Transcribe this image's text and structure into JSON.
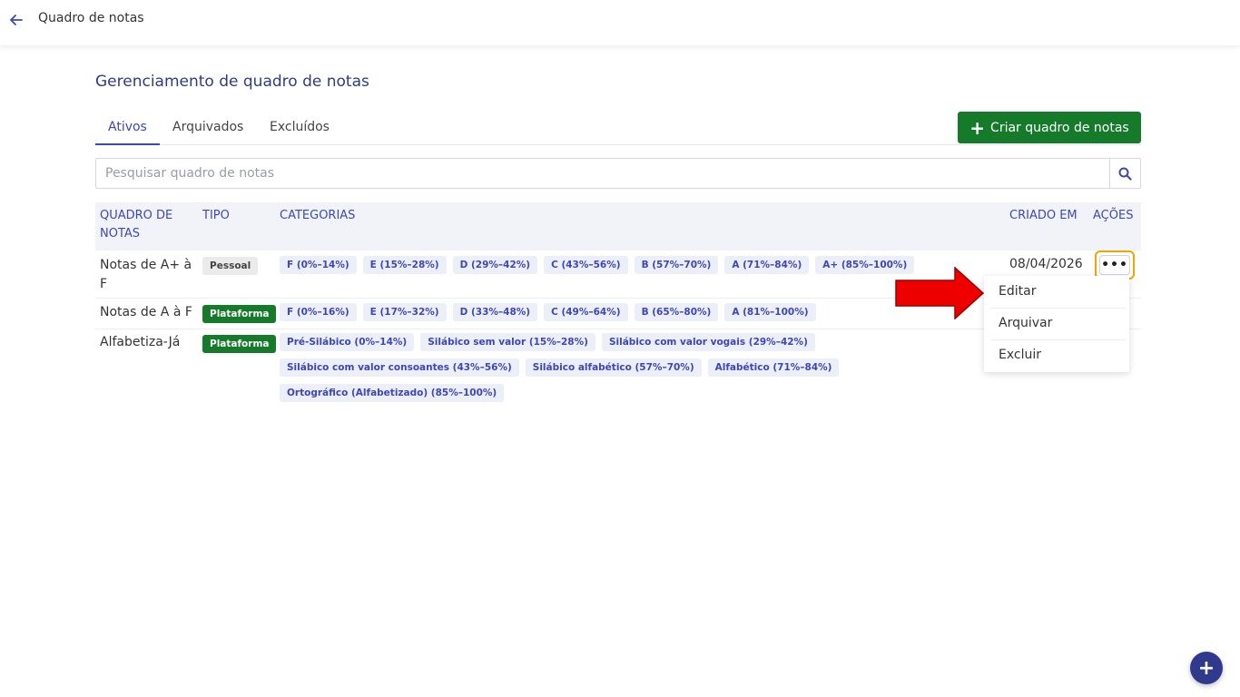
{
  "topbar": {
    "title": "Quadro de notas"
  },
  "page": {
    "title": "Gerenciamento de quadro de notas"
  },
  "tabs": [
    {
      "label": "Ativos",
      "active": true
    },
    {
      "label": "Arquivados",
      "active": false
    },
    {
      "label": "Excluídos",
      "active": false
    }
  ],
  "create_button": {
    "label": "Criar quadro de notas"
  },
  "search": {
    "placeholder": "Pesquisar quadro de notas",
    "value": ""
  },
  "table": {
    "headers": {
      "name_line1": "QUADRO DE",
      "name_line2": "NOTAS",
      "type": "TIPO",
      "categories": "CATEGORIAS",
      "created": "CRIADO EM",
      "actions": "AÇÕES"
    },
    "rows": [
      {
        "name": "Notas de A+ à F",
        "type": "Pessoal",
        "categories": [
          "F (0%–14%)",
          "E (15%–28%)",
          "D (29%–42%)",
          "C (43%–56%)",
          "B (57%–70%)",
          "A (71%–84%)",
          "A+ (85%–100%)"
        ],
        "created": "08/04/2026"
      },
      {
        "name": "Notas de A à F",
        "type": "Plataforma",
        "categories": [
          "F (0%–16%)",
          "E (17%–32%)",
          "D (33%–48%)",
          "C (49%–64%)",
          "B (65%–80%)",
          "A (81%–100%)"
        ],
        "created": ""
      },
      {
        "name": "Alfabetiza-Já",
        "type": "Plataforma",
        "categories": [
          "Pré-Silábico (0%–14%)",
          "Silábico sem valor (15%–28%)",
          "Silábico com valor vogais (29%–42%)",
          "Silábico com valor consoantes (43%–56%)",
          "Silábico alfabético (57%–70%)",
          "Alfabético (71%–84%)",
          "Ortográfico (Alfabetizado) (85%–100%)"
        ],
        "created": ""
      }
    ]
  },
  "actions_menu": {
    "button_glyph": "•••",
    "items": [
      "Editar",
      "Arquivar",
      "Excluir"
    ]
  },
  "fab": {
    "glyph": "+"
  },
  "colors": {
    "primary": "#3d47b8",
    "title": "#2f3a8c",
    "success": "#157a2a",
    "highlight": "#f0a500",
    "arrow": "#ee0000"
  }
}
